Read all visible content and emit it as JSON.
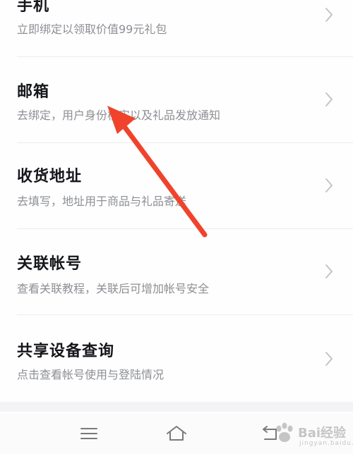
{
  "colors": {
    "title": "#15161a",
    "subtitle": "#8d8f94",
    "chevron": "#c4c4c8",
    "annotation_arrow": "#f0432c",
    "nav_icon": "#7a7a7e"
  },
  "settings_list": [
    {
      "title": "手机",
      "subtitle": "立即绑定以领取价值99元礼包",
      "icon": "chevron-right-icon"
    },
    {
      "title": "邮箱",
      "subtitle": "去绑定，用户身份核实以及礼品发放通知",
      "icon": "chevron-right-icon"
    },
    {
      "title": "收货地址",
      "subtitle": "去填写，地址用于商品与礼品寄送",
      "icon": "chevron-right-icon"
    },
    {
      "title": "关联帐号",
      "subtitle": "查看关联教程，关联后可增加帐号安全",
      "icon": "chevron-right-icon"
    },
    {
      "title": "共享设备查询",
      "subtitle": "点击查看帐号使用与登陆情况",
      "icon": "chevron-right-icon"
    }
  ],
  "nav_bar": {
    "menu_icon": "menu-icon",
    "home_icon": "home-icon",
    "back_icon": "back-icon"
  },
  "watermark": {
    "brand": "Bai",
    "suffix": "经验",
    "url": "jingyan.baidu.com"
  }
}
